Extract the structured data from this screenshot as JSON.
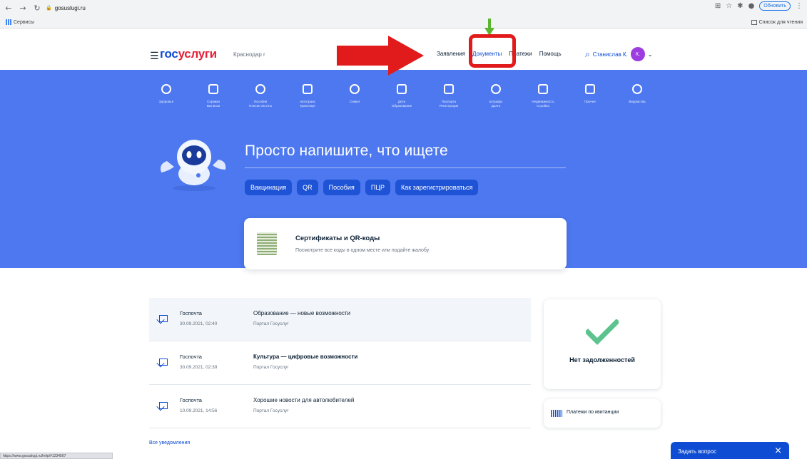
{
  "browser": {
    "url": "gosuslugi.ru",
    "update_label": "Обновить",
    "bookmarks_label": "Сервисы",
    "reading_list_label": "Список для чтения",
    "status_text": "https://www.gosuslugi.ru/help/#1234567"
  },
  "header": {
    "logo_part1": "гос",
    "logo_part2": "услуги",
    "city": "Краснодар г",
    "nav": [
      "Заявления",
      "Документы",
      "Платежи",
      "Помощь"
    ],
    "user_name": "Станислав К.",
    "avatar_initials": "К."
  },
  "categories": [
    {
      "label": "Здоровье"
    },
    {
      "label": "Справки\nВыписки"
    },
    {
      "label": "Пособия\nПенсии Льготы"
    },
    {
      "label": "Автотранс\nТранспорт"
    },
    {
      "label": "Семья"
    },
    {
      "label": "Дети\nОбразование"
    },
    {
      "label": "Паспорта\nРегистрация"
    },
    {
      "label": "Штрафы\nДолги"
    },
    {
      "label": "Недвижимость\nСтройка"
    },
    {
      "label": "Прочее"
    },
    {
      "label": "Ведомства"
    }
  ],
  "hero": {
    "prompt": "Просто напишите, что ищете",
    "chips": [
      "Вакцинация",
      "QR",
      "Пособия",
      "ПЦР",
      "Как зарегистрироваться"
    ]
  },
  "cert_card": {
    "title": "Сертификаты и QR-коды",
    "subtitle": "Посмотрите все коды в одном месте или подайте жалобу"
  },
  "notifications": [
    {
      "from": "Госпочта",
      "date": "30.09.2021, 02:40",
      "subject": "Образование — новые возможности",
      "source": "Портал Госуслуг"
    },
    {
      "from": "Госпочта",
      "date": "30.09.2021, 02:39",
      "subject": "Культура — цифровые возможности",
      "source": "Портал Госуслуг"
    },
    {
      "from": "Госпочта",
      "date": "10.09.2021, 14:56",
      "subject": "Хорошие новости для автолюбителей",
      "source": "Портал Госуслуг"
    }
  ],
  "all_notifications": "Все уведомления",
  "debt": {
    "text": "Нет задолженностей"
  },
  "pay": {
    "text": "Платежи по квитанции"
  },
  "ask": {
    "label": "Задать вопрос",
    "close": "×"
  },
  "colors": {
    "brand_blue": "#0d4cd3",
    "hero_blue": "#4d78ef",
    "accent_red": "#e41d37",
    "annotation_red": "#e11b1b",
    "annotation_green": "#5cb531",
    "check_green": "#5dc38e"
  }
}
